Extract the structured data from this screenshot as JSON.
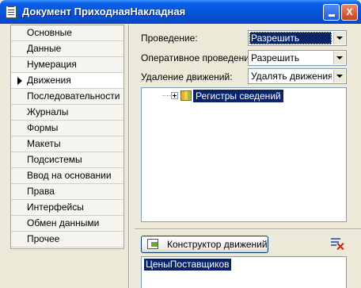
{
  "window": {
    "title": "Документ ПриходнаяНакладная",
    "minimize_label": "",
    "close_label": "X"
  },
  "nav": {
    "items": [
      {
        "label": "Основные"
      },
      {
        "label": "Данные"
      },
      {
        "label": "Нумерация"
      },
      {
        "label": "Движения",
        "active": true
      },
      {
        "label": "Последовательности"
      },
      {
        "label": "Журналы"
      },
      {
        "label": "Формы"
      },
      {
        "label": "Макеты"
      },
      {
        "label": "Подсистемы"
      },
      {
        "label": "Ввод на основании"
      },
      {
        "label": "Права"
      },
      {
        "label": "Интерфейсы"
      },
      {
        "label": "Обмен данными"
      },
      {
        "label": "Прочее"
      }
    ]
  },
  "form": {
    "posting_label": "Проведение:",
    "posting_value": "Разрешить",
    "realtime_label": "Оперативное проведение:",
    "realtime_value": "Разрешить",
    "delete_label": "Удаление движений:",
    "delete_value": "Удалять движения а"
  },
  "tree": {
    "root_label": "Регистры сведений"
  },
  "toolbar": {
    "constructor_label": "Конструктор движений"
  },
  "code": {
    "text": "ЦеныПоставщиков"
  }
}
